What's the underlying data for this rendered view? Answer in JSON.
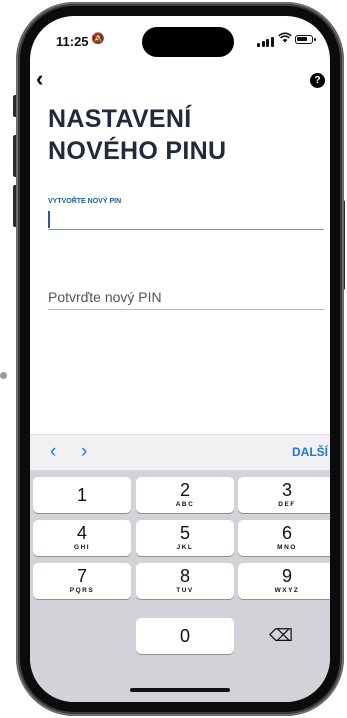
{
  "status_bar": {
    "time": "11:25",
    "bell_icon": "🔕",
    "wifi_icon": "wifi-icon"
  },
  "header": {
    "back": "‹",
    "help": "?"
  },
  "title": {
    "line1": "NASTAVENÍ",
    "line2": "NOVÉHO PINU"
  },
  "form": {
    "new_pin_label": "VYTVOŘTE NOVÝ PIN",
    "confirm_pin_placeholder": "Potvrďte nový PIN"
  },
  "toolbar": {
    "prev": "‹",
    "next": "›",
    "done": "DALŠÍ"
  },
  "keypad": {
    "keys": [
      {
        "num": "1",
        "letters": ""
      },
      {
        "num": "2",
        "letters": "ABC"
      },
      {
        "num": "3",
        "letters": "DEF"
      },
      {
        "num": "4",
        "letters": "GHI"
      },
      {
        "num": "5",
        "letters": "JKL"
      },
      {
        "num": "6",
        "letters": "MNO"
      },
      {
        "num": "7",
        "letters": "PQRS"
      },
      {
        "num": "8",
        "letters": "TUV"
      },
      {
        "num": "9",
        "letters": "WXYZ"
      },
      {
        "num": "0",
        "letters": ""
      }
    ],
    "delete": "⌫"
  }
}
